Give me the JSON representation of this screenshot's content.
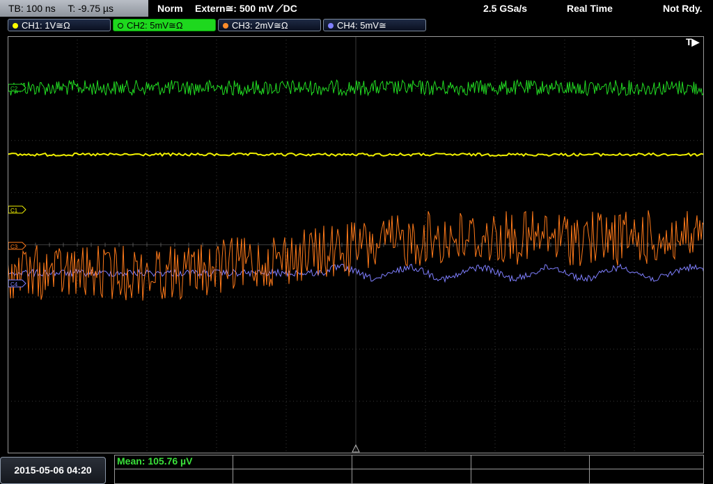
{
  "status": {
    "timebase": "TB: 100 ns",
    "trigger_time": "T: -9.75 µs",
    "mode": "Norm",
    "trigger_source": "Extern≅: 500 mV ⟋DC",
    "sample_rate": "2.5 GSa/s",
    "acq_mode": "Real Time",
    "run_state": "Not Rdy."
  },
  "channels": [
    {
      "label": "CH1: 1V≅Ω",
      "color": "#ffff00"
    },
    {
      "label": "CH2: 5mV≅Ω",
      "color": "#1ed81e"
    },
    {
      "label": "CH3: 2mV≅Ω",
      "color": "#ff8c2a"
    },
    {
      "label": "CH4: 5mV≅",
      "color": "#8080ff"
    }
  ],
  "markers": {
    "c1": "C1",
    "c2": "C2",
    "c3": "C3",
    "c4": "C4",
    "trigger": "T▶"
  },
  "measurement": {
    "mean": "Mean: 105.76 µV"
  },
  "datetime": "2015-05-06 04:20",
  "colors": {
    "ch1": "#f0f000",
    "ch2": "#22dd22",
    "ch3": "#ff7a1a",
    "ch4": "#7f7fff",
    "grid": "#3a3a3a"
  }
}
